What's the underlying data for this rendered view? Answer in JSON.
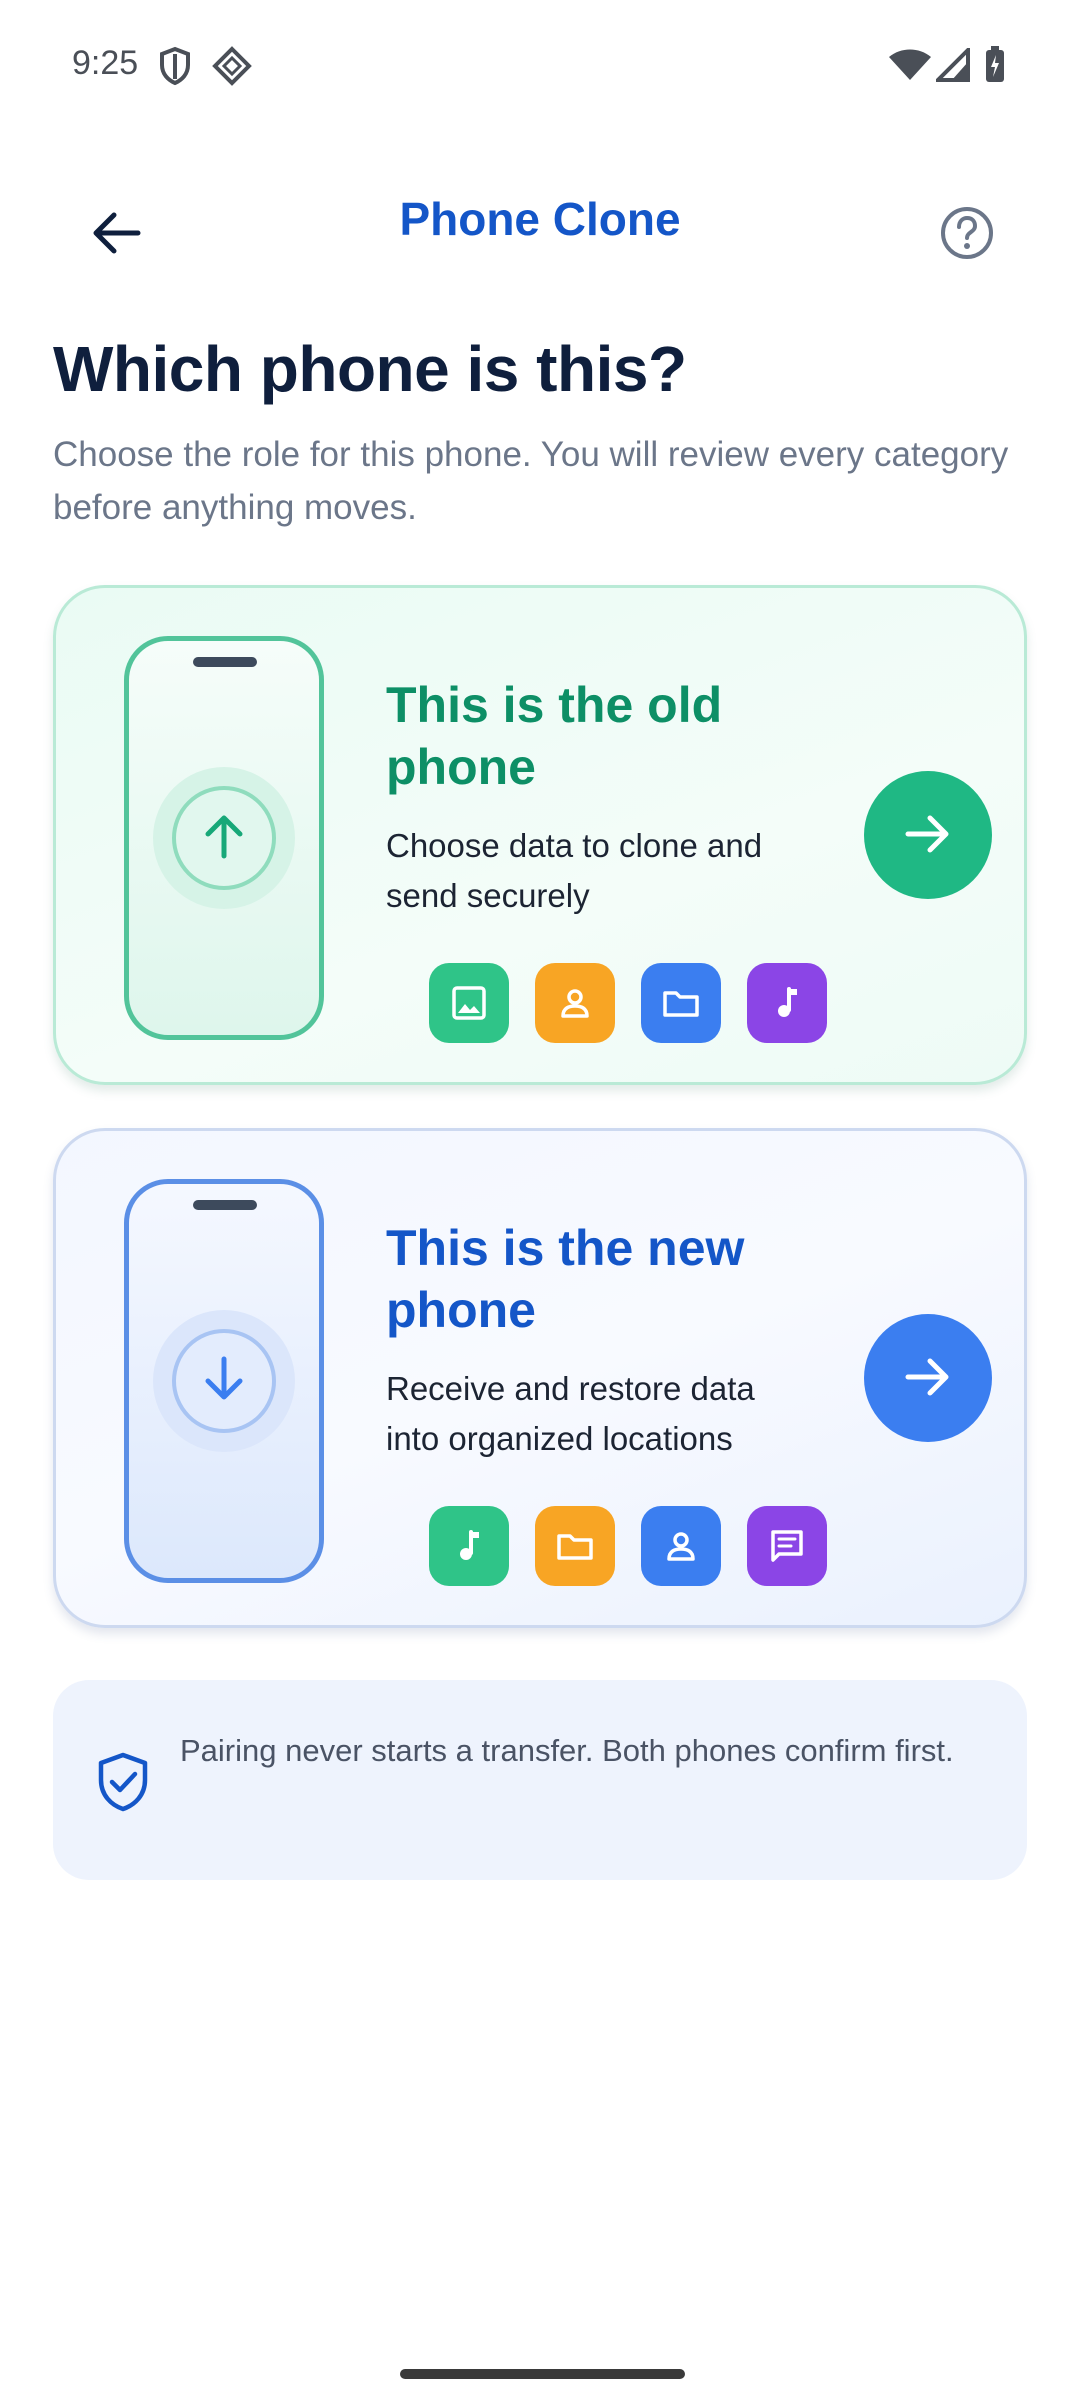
{
  "status_bar": {
    "time": "9:25",
    "icons": [
      "shield-status-icon",
      "diamond-status-icon",
      "wifi-icon",
      "signal-icon",
      "battery-charging-icon"
    ]
  },
  "app_bar": {
    "title": "Phone Clone",
    "back_icon": "arrow-left-icon",
    "help_icon": "help-circle-icon"
  },
  "heading": "Which phone is this?",
  "subheading": "Choose the role for this phone. You will review every category before anything moves.",
  "cards": [
    {
      "id": "old",
      "title": "This is the old phone",
      "description": "Choose data to clone and send securely",
      "badge_icon": "arrow-up-icon",
      "accent": "#1fb884",
      "chips": [
        {
          "icon": "image-icon",
          "color": "#2fc488"
        },
        {
          "icon": "contact-icon",
          "color": "#f8a524"
        },
        {
          "icon": "folder-icon",
          "color": "#3b7ef0"
        },
        {
          "icon": "music-icon",
          "color": "#8b45e6"
        }
      ]
    },
    {
      "id": "new",
      "title": "This is the new phone",
      "description": "Receive and restore data into organized locations",
      "badge_icon": "arrow-down-icon",
      "accent": "#3b7ef0",
      "chips": [
        {
          "icon": "music-icon",
          "color": "#2fc488"
        },
        {
          "icon": "folder-icon",
          "color": "#f8a524"
        },
        {
          "icon": "contact-icon",
          "color": "#3b7ef0"
        },
        {
          "icon": "message-icon",
          "color": "#8b45e6"
        }
      ]
    }
  ],
  "info": {
    "text": "Pairing never starts a transfer. Both phones confirm first.",
    "icon": "shield-check-icon"
  }
}
